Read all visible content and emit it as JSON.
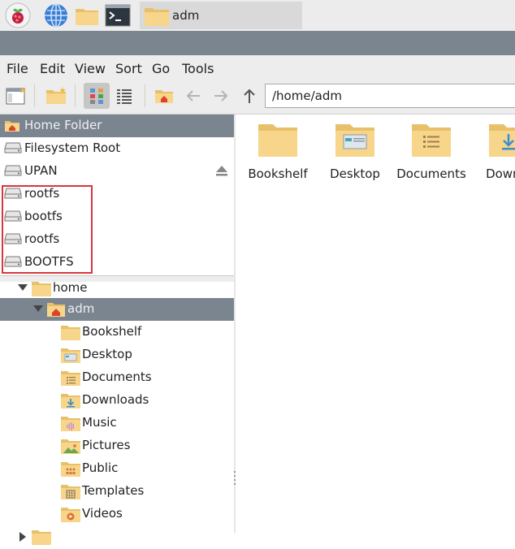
{
  "taskbar": {
    "icons": [
      "raspberry-menu-icon",
      "web-browser-icon",
      "file-manager-icon",
      "terminal-icon"
    ],
    "task_label": "adm"
  },
  "menubar": {
    "items": [
      "File",
      "Edit",
      "View",
      "Sort",
      "Go",
      "Tools"
    ]
  },
  "toolbar": {
    "path": "/home/adm"
  },
  "places": [
    {
      "label": "Home Folder",
      "icon": "home-icon",
      "selected": true
    },
    {
      "label": "Filesystem Root",
      "icon": "drive-icon"
    },
    {
      "label": "UPAN",
      "icon": "drive-icon",
      "eject": true
    },
    {
      "label": "rootfs",
      "icon": "drive-icon"
    },
    {
      "label": "bootfs",
      "icon": "drive-icon"
    },
    {
      "label": "rootfs",
      "icon": "drive-icon"
    },
    {
      "label": "BOOTFS",
      "icon": "drive-icon"
    }
  ],
  "tree": [
    {
      "label": "home",
      "expanded": true
    },
    {
      "label": "adm",
      "expanded": true,
      "selected": true
    },
    {
      "label": "Bookshelf"
    },
    {
      "label": "Desktop"
    },
    {
      "label": "Documents"
    },
    {
      "label": "Downloads"
    },
    {
      "label": "Music"
    },
    {
      "label": "Pictures"
    },
    {
      "label": "Public"
    },
    {
      "label": "Templates"
    },
    {
      "label": "Videos"
    }
  ],
  "files": [
    {
      "label": "Bookshelf",
      "icon": "folder-icon"
    },
    {
      "label": "Desktop",
      "icon": "desktop-folder-icon"
    },
    {
      "label": "Documents",
      "icon": "documents-folder-icon"
    },
    {
      "label": "Downlo",
      "icon": "downloads-folder-icon"
    }
  ],
  "colors": {
    "selection": "#7b858f",
    "folder": "#f7d58a",
    "highlight_border": "#d9363e"
  }
}
